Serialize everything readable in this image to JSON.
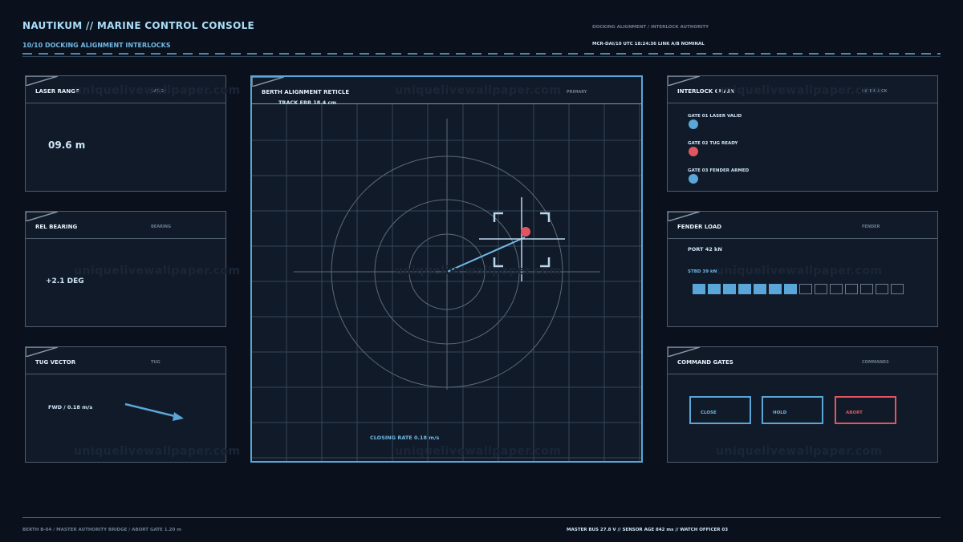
{
  "header": {
    "title": "NAUTIKUM // MARINE CONTROL CONSOLE",
    "subtitle": "10/10 DOCKING ALIGNMENT INTERLOCKS",
    "right_top": "DOCKING ALIGNMENT / INTERLOCK AUTHORITY",
    "right_status": "MCR-DAI/10   UTC 18:24:36   LINK A/B NOMINAL"
  },
  "laser_range": {
    "title": "LASER RANGE",
    "tag": "RANGE",
    "value": "09.6 m"
  },
  "rel_bearing": {
    "title": "REL BEARING",
    "tag": "BEARING",
    "value": "+2.1 DEG"
  },
  "tug_vector": {
    "title": "TUG VECTOR",
    "tag": "TUG",
    "value": "FWD / 0.18 m/s"
  },
  "reticle": {
    "title": "BERTH ALIGNMENT RETICLE",
    "tag": "PRIMARY",
    "track_err": "TRACK ERR 18.4 cm",
    "closing_rate": "CLOSING RATE 0.18 m/s"
  },
  "interlock": {
    "title": "INTERLOCK CHAIN",
    "tag": "INTERLOCK",
    "gates": [
      {
        "label": "GATE 01 LASER VALID",
        "color": "#5aa6d8"
      },
      {
        "label": "GATE 02 TUG READY",
        "color": "#e05561"
      },
      {
        "label": "GATE 03 FENDER ARMED",
        "color": "#5aa6d8"
      }
    ]
  },
  "fender": {
    "title": "FENDER LOAD",
    "tag": "FENDER",
    "port": "PORT 42 kN",
    "stbd": "STBD 39 kN",
    "load_fraction": 0.5
  },
  "commands": {
    "title": "COMMAND GATES",
    "tag": "COMMANDS",
    "close": "CLOSE",
    "hold": "HOLD",
    "abort": "ABORT"
  },
  "footer": {
    "left": "BERTH B-04 / MASTER AUTHORITY BRIDGE / ABORT GATE 1.20 m",
    "right": "MASTER BUS 27.8 V  //  SENSOR AGE 842 ms  //  WATCH OFFICER 03"
  },
  "watermark": "uniquelivewallpaper.com",
  "colors": {
    "accent": "#5aa6d8",
    "alert": "#e05561",
    "background": "#0b111c"
  }
}
